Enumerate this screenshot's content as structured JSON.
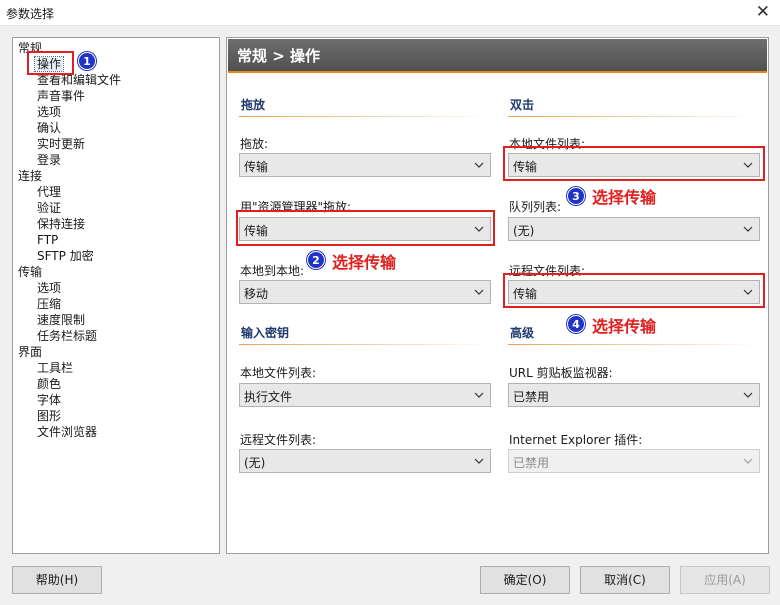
{
  "window": {
    "title": "参数选择",
    "close_glyph": "✕"
  },
  "tree": [
    {
      "label": "常规"
    },
    {
      "label": "操作"
    },
    {
      "label": "查看和编辑文件"
    },
    {
      "label": "声音事件"
    },
    {
      "label": "选项"
    },
    {
      "label": "确认"
    },
    {
      "label": "实时更新"
    },
    {
      "label": "登录"
    },
    {
      "label": "连接"
    },
    {
      "label": "代理"
    },
    {
      "label": "验证"
    },
    {
      "label": "保持连接"
    },
    {
      "label": "FTP"
    },
    {
      "label": "SFTP 加密"
    },
    {
      "label": "传输"
    },
    {
      "label": "选项"
    },
    {
      "label": "压缩"
    },
    {
      "label": "速度限制"
    },
    {
      "label": "任务栏标题"
    },
    {
      "label": "界面"
    },
    {
      "label": "工具栏"
    },
    {
      "label": "颜色"
    },
    {
      "label": "字体"
    },
    {
      "label": "图形"
    },
    {
      "label": "文件浏览器"
    }
  ],
  "header": {
    "title": "常规 > 操作"
  },
  "sections": {
    "drag": "拖放",
    "dblclick": "双击",
    "input_key": "输入密钥",
    "advanced": "高级"
  },
  "fields": {
    "drag_label": "拖放:",
    "drag_value": "传输",
    "explorer_label": "用\"资源管理器\"拖放:",
    "explorer_value": "传输",
    "local_to_local_label": "本地到本地:",
    "local_to_local_value": "移动",
    "dbl_local_label": "本地文件列表:",
    "dbl_local_value": "传输",
    "queue_label": "队列列表:",
    "queue_value": "(无)",
    "dbl_remote_label": "远程文件列表:",
    "dbl_remote_value": "传输",
    "key_local_label": "本地文件列表:",
    "key_local_value": "执行文件",
    "key_remote_label": "远程文件列表:",
    "key_remote_value": "(无)",
    "url_label": "URL 剪贴板监视器:",
    "url_value": "已禁用",
    "ie_label": "Internet Explorer 插件:",
    "ie_value": "已禁用"
  },
  "annotations": {
    "b1": "1",
    "b2": "2",
    "b3": "3",
    "b4": "4",
    "c2": "选择传输",
    "c3": "选择传输",
    "c4": "选择传输"
  },
  "buttons": {
    "help": "帮助(H)",
    "ok": "确定(O)",
    "cancel": "取消(C)",
    "apply": "应用(A)"
  },
  "colors": {
    "accent": "#e08a1e",
    "header": "#5a5a5a",
    "annotation": "#e0201e",
    "badge": "#2233c8"
  }
}
